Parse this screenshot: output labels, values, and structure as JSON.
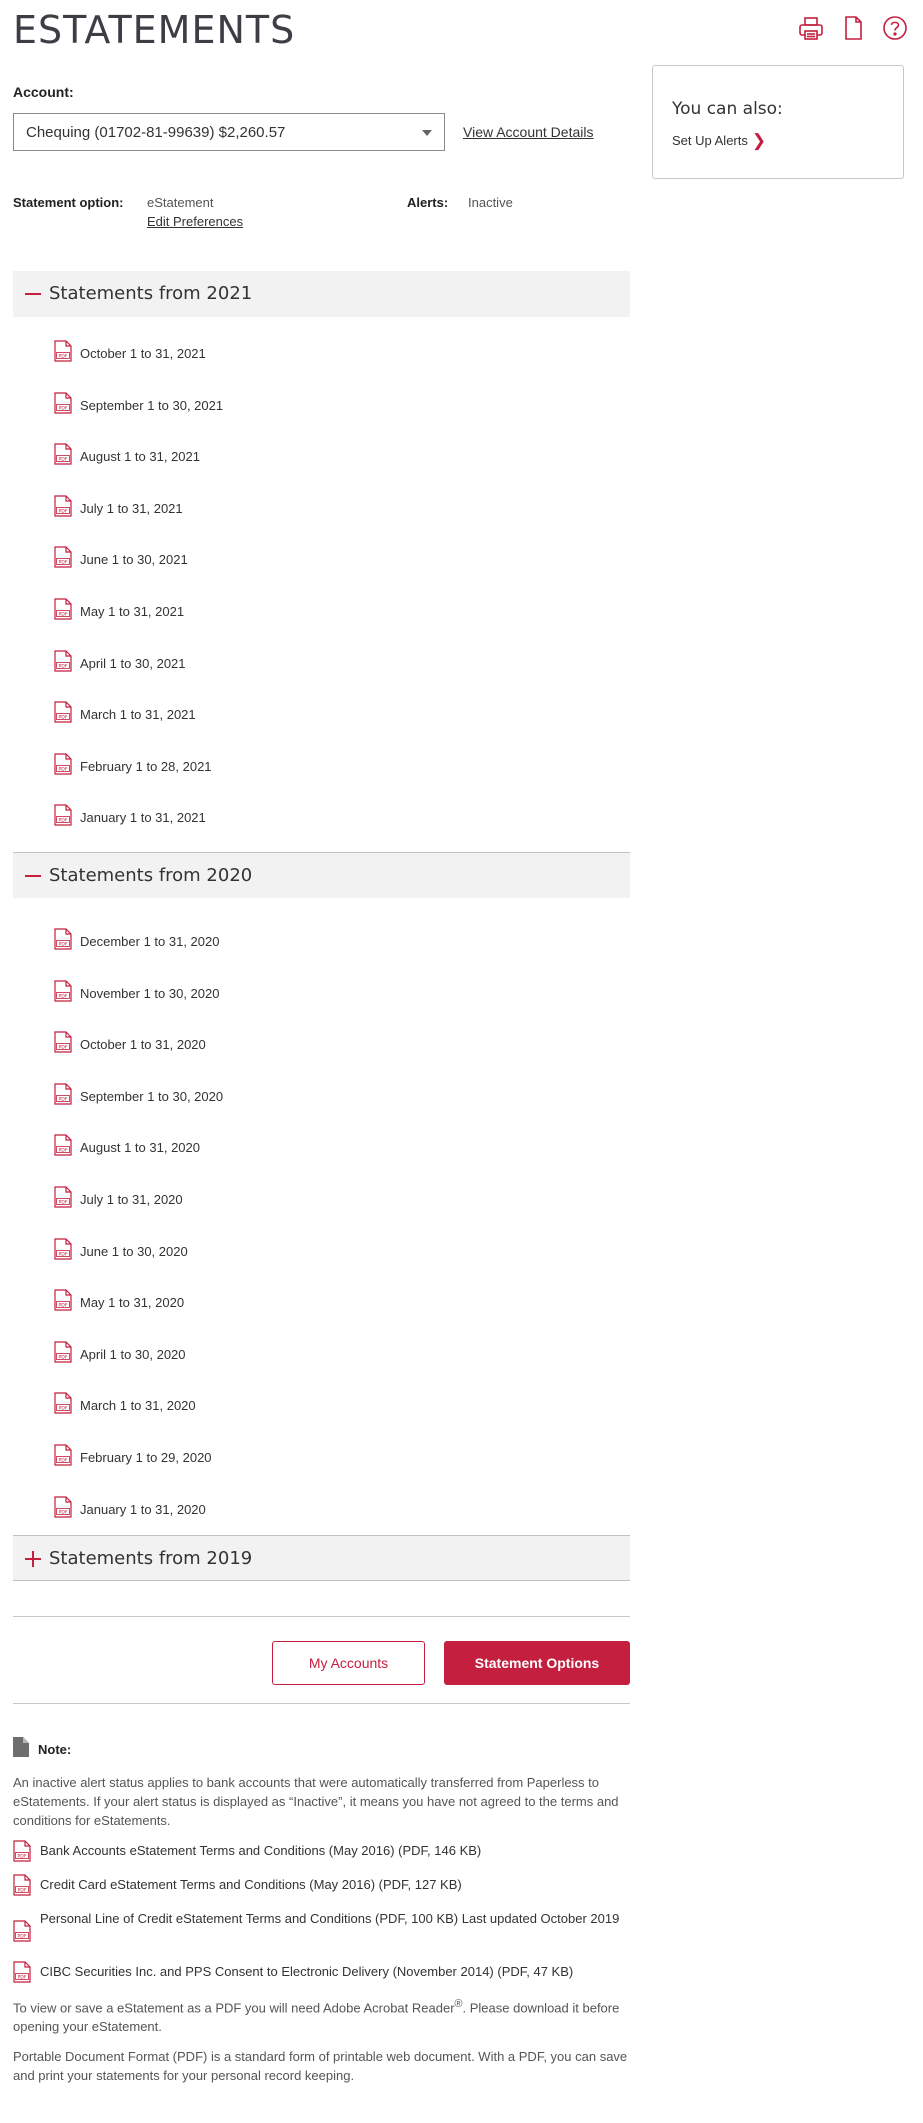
{
  "header": {
    "title": "ESTATEMENTS",
    "icons": [
      "printer-icon",
      "document-icon",
      "help-icon"
    ]
  },
  "account": {
    "label": "Account:",
    "selected": "Chequing (01702-81-99639) $2,260.57",
    "view_details": "View Account Details"
  },
  "statement_option": {
    "label": "Statement option:",
    "value": "eStatement",
    "edit_link": "Edit Preferences"
  },
  "alerts": {
    "label": "Alerts:",
    "value": "Inactive"
  },
  "sidebar": {
    "title": "You can also:",
    "link": "Set Up Alerts"
  },
  "sections": [
    {
      "title": "Statements from 2021",
      "expanded": true,
      "items": [
        "October 1 to 31, 2021",
        "September 1 to 30, 2021",
        "August 1 to 31, 2021",
        "July 1 to 31, 2021",
        "June 1 to 30, 2021",
        "May 1 to 31, 2021",
        "April 1 to 30, 2021",
        "March 1 to 31, 2021",
        "February 1 to 28, 2021",
        "January 1 to 31, 2021"
      ]
    },
    {
      "title": "Statements from 2020",
      "expanded": true,
      "items": [
        "December 1 to 31, 2020",
        "November 1 to 30, 2020",
        "October 1 to 31, 2020",
        "September 1 to 30, 2020",
        "August 1 to 31, 2020",
        "July 1 to 31, 2020",
        "June 1 to 30, 2020",
        "May 1 to 31, 2020",
        "April 1 to 30, 2020",
        "March 1 to 31, 2020",
        "February 1 to 29, 2020",
        "January 1 to 31, 2020"
      ]
    },
    {
      "title": "Statements from 2019",
      "expanded": false,
      "items": []
    }
  ],
  "buttons": {
    "my_accounts": "My Accounts",
    "statement_options": "Statement Options"
  },
  "note": {
    "label": "Note:",
    "paragraph": "An inactive alert status applies to bank accounts that were automatically transferred from Paperless to eStatements. If your alert status is displayed as “Inactive”, it means you have not agreed to the terms and conditions for eStatements.",
    "documents": [
      "Bank Accounts eStatement Terms and Conditions (May 2016) (PDF, 146 KB)",
      "Credit Card eStatement Terms and Conditions (May 2016) (PDF, 127 KB)",
      "Personal Line of Credit eStatement Terms and Conditions (PDF, 100 KB) Last updated October 2019",
      "CIBC Securities Inc. and PPS Consent to Electronic Delivery (November 2014) (PDF, 47 KB)"
    ],
    "acrobat_text_1": "To view or save a eStatement as a PDF you will need Adobe Acrobat Reader",
    "acrobat_sup": "®",
    "acrobat_text_2": ". Please download it before opening your eStatement.",
    "pdf_paragraph": "Portable Document Format (PDF) is a standard form of printable web document. With a PDF, you can save and print your statements for your personal record keeping."
  },
  "colors": {
    "accent": "#c41f3e",
    "section_bg": "#f2f2f2",
    "text": "#333333"
  }
}
